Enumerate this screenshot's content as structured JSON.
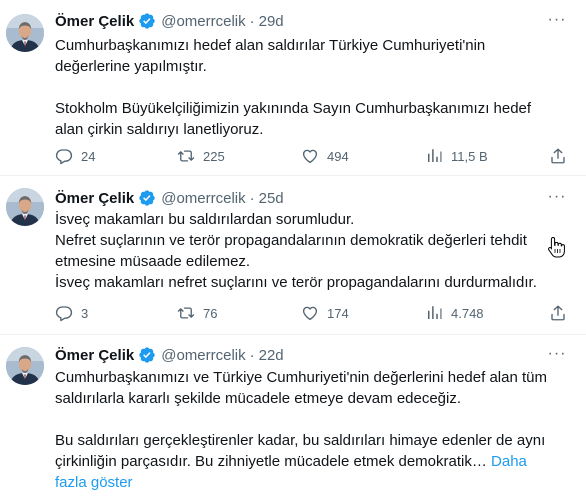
{
  "tweets": [
    {
      "author": "Ömer Çelik",
      "handle": "@omerrcelik",
      "separator": "·",
      "time": "29d",
      "paragraphs": [
        [
          "Cumhurbaşkanımızı hedef alan saldırılar Türkiye Cumhuriyeti'nin",
          "değerlerine yapılmıştır."
        ],
        [
          "Stokholm Büyükelçiliğimizin yakınında Sayın Cumhurbaşkanımızı hedef",
          "alan çirkin saldırıyı lanetliyoruz."
        ]
      ],
      "replies": "24",
      "retweets": "225",
      "likes": "494",
      "views": "11,5 B"
    },
    {
      "author": "Ömer Çelik",
      "handle": "@omerrcelik",
      "separator": "·",
      "time": "25d",
      "lines": [
        "İsveç makamları bu saldırılardan sorumludur.",
        "Nefret suçlarının ve terör propagandalarının demokratik değerleri tehdit",
        "etmesine müsaade edilemez.",
        "İsveç makamları nefret suçlarını ve terör propagandalarını durdurmalıdır."
      ],
      "replies": "3",
      "retweets": "76",
      "likes": "174",
      "views": "4.748"
    },
    {
      "author": "Ömer Çelik",
      "handle": "@omerrcelik",
      "separator": "·",
      "time": "22d",
      "paragraphs": [
        [
          "Cumhurbaşkanımızı ve Türkiye Cumhuriyeti'nin değerlerini hedef alan tüm",
          "saldırılarla kararlı şekilde mücadele etmeye devam edeceğiz."
        ],
        [
          "Bu saldırıları gerçekleştirenler kadar, bu saldırıları himaye edenler de aynı",
          "çirkinliğin parçasıdır. Bu zihniyetle mücadele etmek demokratik…"
        ]
      ],
      "show_more_1": "Daha",
      "show_more_2": "fazla göster"
    }
  ],
  "more_symbol": "···",
  "colors": {
    "text": "#0f1419",
    "secondary": "#536471",
    "accent": "#1d9bf0",
    "divider": "#eff3f4"
  },
  "icons": {
    "verified": "verified-badge-icon",
    "more": "more-options-icon",
    "reply": "reply-icon",
    "retweet": "retweet-icon",
    "like": "like-icon",
    "views": "views-icon",
    "share": "share-icon"
  }
}
